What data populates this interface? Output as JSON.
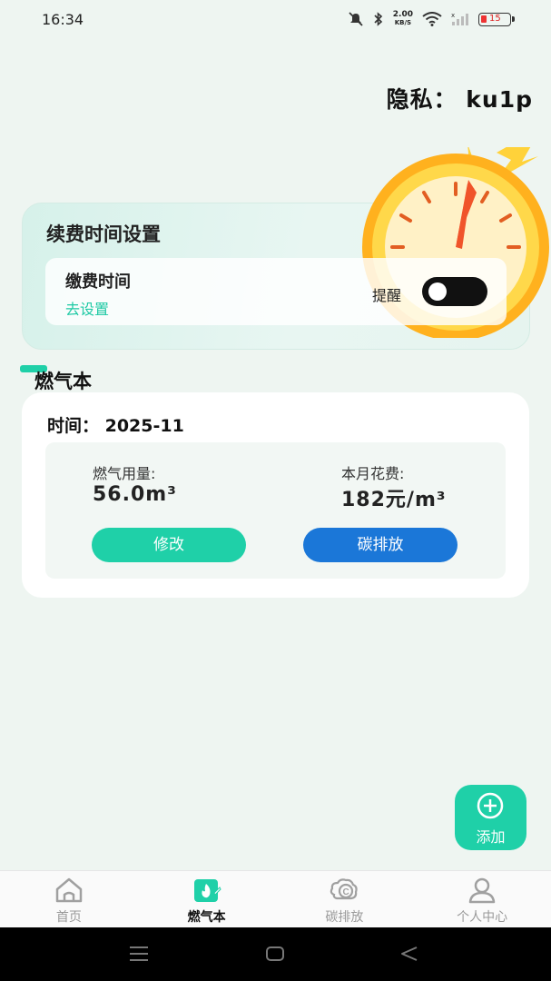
{
  "status_bar": {
    "time": "16:34",
    "net_speed_value": "2.00",
    "net_speed_unit": "KB/S",
    "battery": "15",
    "icons": [
      "mute-icon",
      "bluetooth-icon",
      "wifi-icon",
      "signal-icon",
      "battery-icon"
    ]
  },
  "header": {
    "privacy_text": "隐私： ku1p"
  },
  "renewal": {
    "title": "续费时间设置",
    "pay_label": "缴费时间",
    "pay_link": "去设置",
    "remind_label": "提醒"
  },
  "section": {
    "title": "燃气本"
  },
  "gas_card": {
    "time_text": "时间：  2025-11",
    "usage_label": "燃气用量:",
    "usage_value": "56.0m³",
    "cost_label": "本月花费:",
    "cost_value": "182元/m³",
    "edit_button": "修改",
    "carbon_button": "碳排放"
  },
  "fab": {
    "label": "添加"
  },
  "tabbar": {
    "tabs": [
      {
        "label": "首页",
        "icon": "home-icon"
      },
      {
        "label": "燃气本",
        "icon": "gas-book-icon"
      },
      {
        "label": "碳排放",
        "icon": "carbon-icon"
      },
      {
        "label": "个人中心",
        "icon": "user-icon"
      }
    ],
    "active_index": 1
  },
  "colors": {
    "accent": "#1fd0a8",
    "blue_button": "#1b77d8",
    "background": "#eef5f1"
  }
}
